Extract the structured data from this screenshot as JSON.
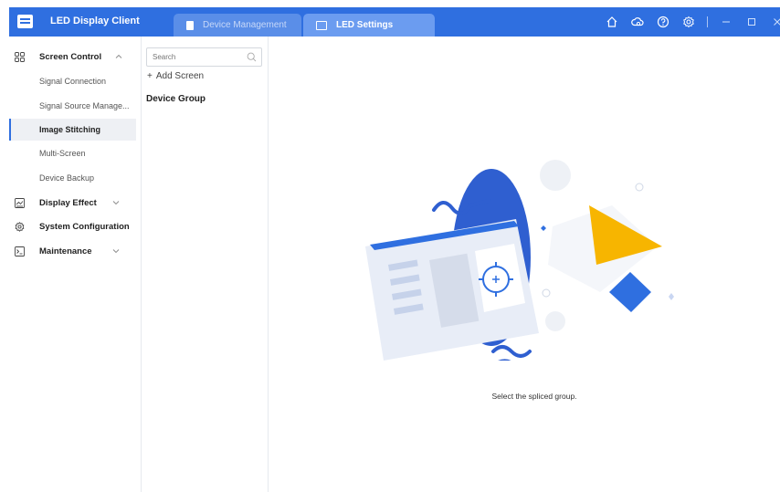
{
  "titlebar": {
    "app_title": "LED Display Client",
    "tabs": [
      {
        "label": "Device Management",
        "icon": "document-icon",
        "active": false
      },
      {
        "label": "LED Settings",
        "icon": "led-icon",
        "active": true
      }
    ],
    "controls": [
      "home-icon",
      "cloud-upgrade-icon",
      "help-icon",
      "settings-icon",
      "minimize-icon",
      "maximize-icon",
      "close-icon"
    ],
    "accent_color": "#2f6fe0"
  },
  "sidebar": {
    "groups": [
      {
        "label": "Screen Control",
        "icon": "grid-icon",
        "expanded": true,
        "items": [
          "Signal Connection",
          "Signal Source Manage...",
          "Image Stitching",
          "Multi-Screen",
          "Device Backup"
        ],
        "active_item": "Image Stitching"
      },
      {
        "label": "Display Effect",
        "icon": "display-icon",
        "expanded": false
      },
      {
        "label": "System Configuration",
        "icon": "gear-icon",
        "expanded": false
      },
      {
        "label": "Maintenance",
        "icon": "maintenance-icon",
        "expanded": false
      }
    ]
  },
  "group_panel": {
    "search_placeholder": "Search",
    "add_screen_label": "Add Screen",
    "add_screen_symbol": "+",
    "device_group_label": "Device Group"
  },
  "main": {
    "empty_state_text": "Select the spliced group."
  }
}
